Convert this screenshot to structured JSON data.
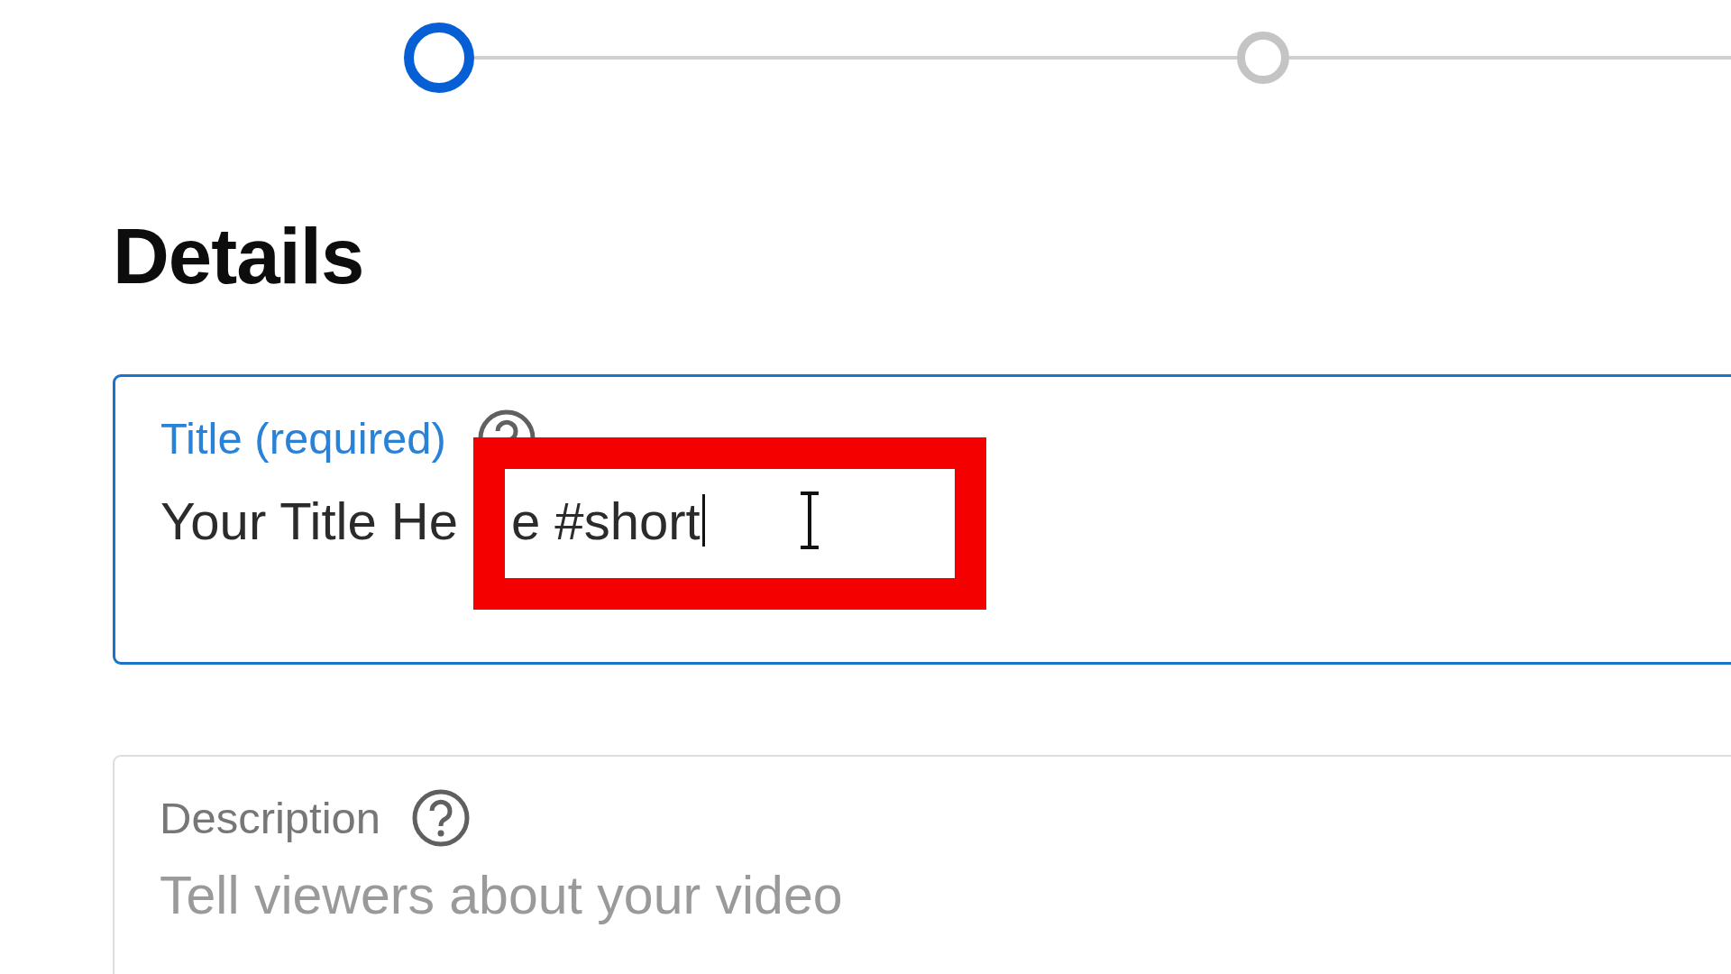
{
  "stepper": {
    "steps": [
      {
        "selected": true
      },
      {
        "selected": false
      }
    ]
  },
  "heading": "Details",
  "title_field": {
    "label": "Title (required)",
    "value_parts": [
      "Your Title He",
      "e #short"
    ],
    "focused": true
  },
  "highlight_frame": true,
  "description_field": {
    "label": "Description",
    "placeholder": "Tell viewers about your video",
    "focused": false
  }
}
